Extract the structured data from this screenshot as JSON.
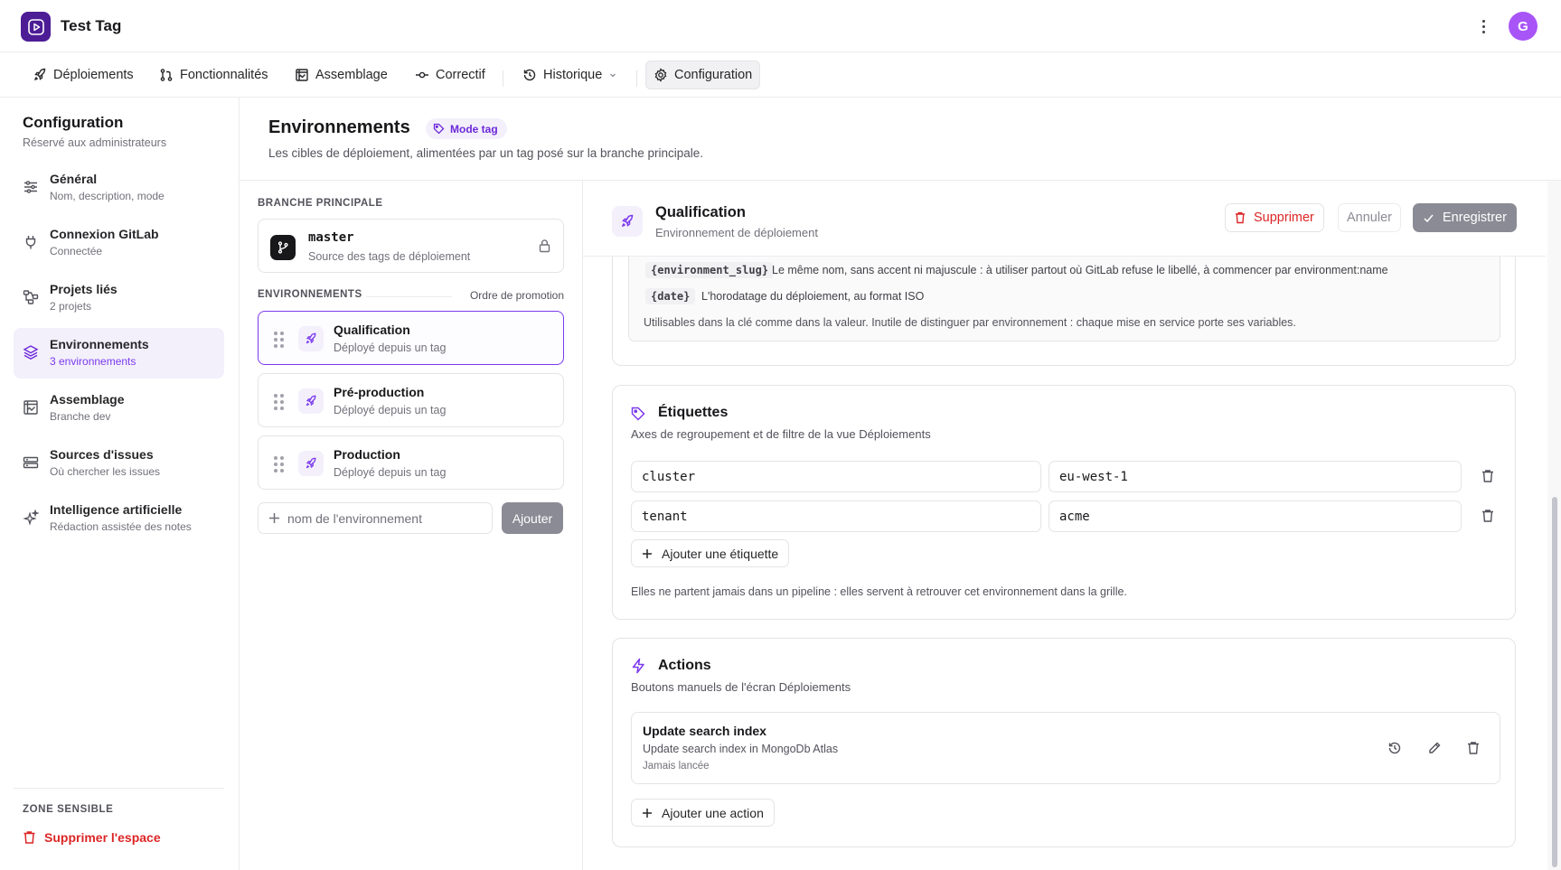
{
  "app": {
    "title": "Test Tag",
    "avatar_initial": "G",
    "brand_color": "#4c1d95",
    "avatar_color": "#a855f7"
  },
  "nav": {
    "items": [
      {
        "label": "Déploiements",
        "icon": "rocket-icon"
      },
      {
        "label": "Fonctionnalités",
        "icon": "git-pull-request-icon"
      },
      {
        "label": "Assemblage",
        "icon": "frame-icon"
      },
      {
        "label": "Correctif",
        "icon": "git-commit-icon"
      },
      {
        "label": "Historique",
        "icon": "history-icon"
      },
      {
        "label": "Configuration",
        "icon": "gear-icon",
        "active": true
      }
    ]
  },
  "sidebar": {
    "title": "Configuration",
    "subtitle": "Réservé aux administrateurs",
    "items": [
      {
        "label": "Général",
        "sub": "Nom, description, mode",
        "icon": "sliders-icon"
      },
      {
        "label": "Connexion GitLab",
        "sub": "Connectée",
        "icon": "plug-icon"
      },
      {
        "label": "Projets liés",
        "sub": "2 projets",
        "icon": "network-icon"
      },
      {
        "label": "Environnements",
        "sub": "3 environnements",
        "icon": "layers-icon",
        "active": true
      },
      {
        "label": "Assemblage",
        "sub": "Branche dev",
        "icon": "frame-icon"
      },
      {
        "label": "Sources d'issues",
        "sub": "Où chercher les issues",
        "icon": "server-icon"
      },
      {
        "label": "Intelligence artificielle",
        "sub": "Rédaction assistée des notes",
        "icon": "sparkles-icon"
      }
    ],
    "danger_title": "ZONE SENSIBLE",
    "danger_link": "Supprimer l'espace"
  },
  "page": {
    "title": "Environnements",
    "badge": "Mode tag",
    "description": "Les cibles de déploiement, alimentées par un tag posé sur la branche principale."
  },
  "main_branch": {
    "section_label": "BRANCHE PRINCIPALE",
    "name": "master",
    "sub": "Source des tags de déploiement"
  },
  "environments": {
    "section_label": "ENVIRONNEMENTS",
    "order_label": "Ordre de promotion",
    "items": [
      {
        "name": "Qualification",
        "sub": "Déployé depuis un tag",
        "active": true
      },
      {
        "name": "Pré-production",
        "sub": "Déployé depuis un tag"
      },
      {
        "name": "Production",
        "sub": "Déployé depuis un tag"
      }
    ],
    "add_placeholder": "nom de l'environnement",
    "add_button": "Ajouter"
  },
  "detail": {
    "title": "Qualification",
    "subtitle": "Environnement de déploiement",
    "delete_label": "Supprimer",
    "cancel_label": "Annuler",
    "save_label": "Enregistrer",
    "variables": [
      {
        "code": "{environment_slug}",
        "desc": "Le même nom, sans accent ni majuscule : à utiliser partout où GitLab refuse le libellé, à commencer par environment:name"
      },
      {
        "code": "{date}",
        "desc": "L'horodatage du déploiement, au format ISO"
      }
    ],
    "variables_note": "Utilisables dans la clé comme dans la valeur. Inutile de distinguer par environnement : chaque mise en service porte ses variables.",
    "labels": {
      "title": "Étiquettes",
      "subtitle": "Axes de regroupement et de filtre de la vue Déploiements",
      "rows": [
        {
          "key": "cluster",
          "value": "eu-west-1"
        },
        {
          "key": "tenant",
          "value": "acme"
        }
      ],
      "add_label": "Ajouter une étiquette",
      "footer": "Elles ne partent jamais dans un pipeline : elles servent à retrouver cet environnement dans la grille."
    },
    "actions": {
      "title": "Actions",
      "subtitle": "Boutons manuels de l'écran Déploiements",
      "items": [
        {
          "title": "Update search index",
          "sub": "Update search index in MongoDb Atlas",
          "meta": "Jamais lancée"
        }
      ],
      "add_label": "Ajouter une action"
    }
  }
}
